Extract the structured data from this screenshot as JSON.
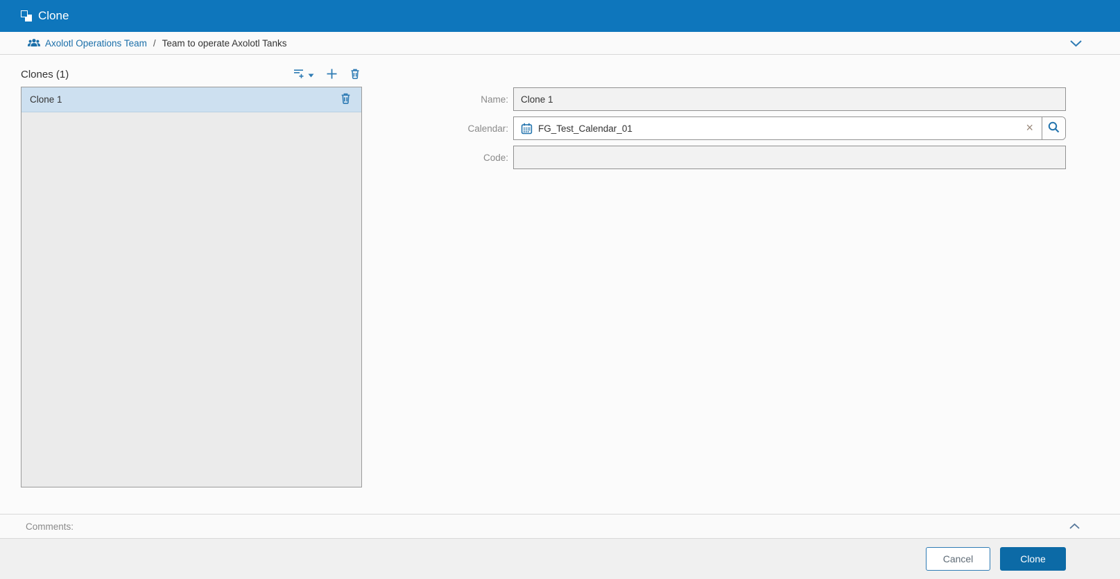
{
  "window": {
    "title": "Clone"
  },
  "breadcrumb": {
    "team_label": "Axolotl Operations Team",
    "separator": "/",
    "current_label": "Team to operate Axolotl Tanks"
  },
  "clones_panel": {
    "title": "Clones (1)",
    "items": [
      {
        "label": "Clone 1",
        "selected": true
      }
    ]
  },
  "form": {
    "name": {
      "label": "Name:",
      "value": "Clone 1"
    },
    "calendar": {
      "label": "Calendar:",
      "value": "FG_Test_Calendar_01",
      "clear_glyph": "×"
    },
    "code": {
      "label": "Code:",
      "value": ""
    }
  },
  "comments": {
    "label": "Comments:"
  },
  "footer": {
    "cancel_label": "Cancel",
    "submit_label": "Clone"
  },
  "icons": {
    "clone-icon": "two overlapping squares",
    "team-icon": "group of people",
    "chevron-down-icon": "v chevron",
    "chevron-up-icon": "^ chevron",
    "filter-add-icon": "lines with plus",
    "caret-down-icon": "small solid triangle",
    "plus-icon": "+",
    "trash-icon": "waste bin",
    "calendar-icon": "calendar grid",
    "clear-x-icon": "×",
    "search-icon": "magnifying glass"
  },
  "colors": {
    "titlebar_bg": "#0e76bc",
    "accent_icon": "#2e7bb4",
    "link": "#1b6fa9",
    "selected_row_bg": "#cde0f0",
    "primary_button_bg": "#0c6aa6",
    "input_readonly_bg": "#f2f2f2",
    "panel_bg": "#ebebeb"
  }
}
